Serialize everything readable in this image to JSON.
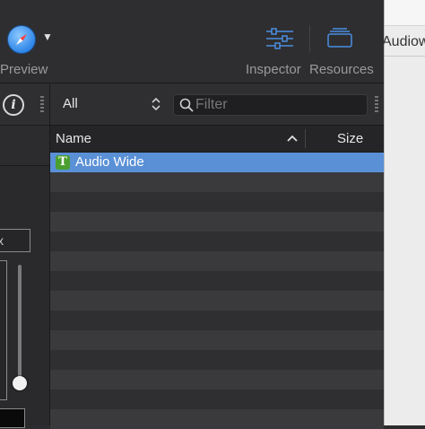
{
  "toolbar": {
    "preview_label": "Preview",
    "inspector_label": "Inspector",
    "resources_label": "Resources",
    "accent_color": "#4a8de0"
  },
  "side_window": {
    "tab_text": "Audiow"
  },
  "left_panel": {
    "info_icon": "info-circle-icon",
    "field_text": "x"
  },
  "main": {
    "scope_value": "All",
    "filter_placeholder": "Filter",
    "columns": {
      "name": "Name",
      "size": "Size"
    },
    "rows": [
      {
        "name": "Audio Wide",
        "size": "",
        "icon": "font-t-icon",
        "selected": true
      }
    ]
  }
}
